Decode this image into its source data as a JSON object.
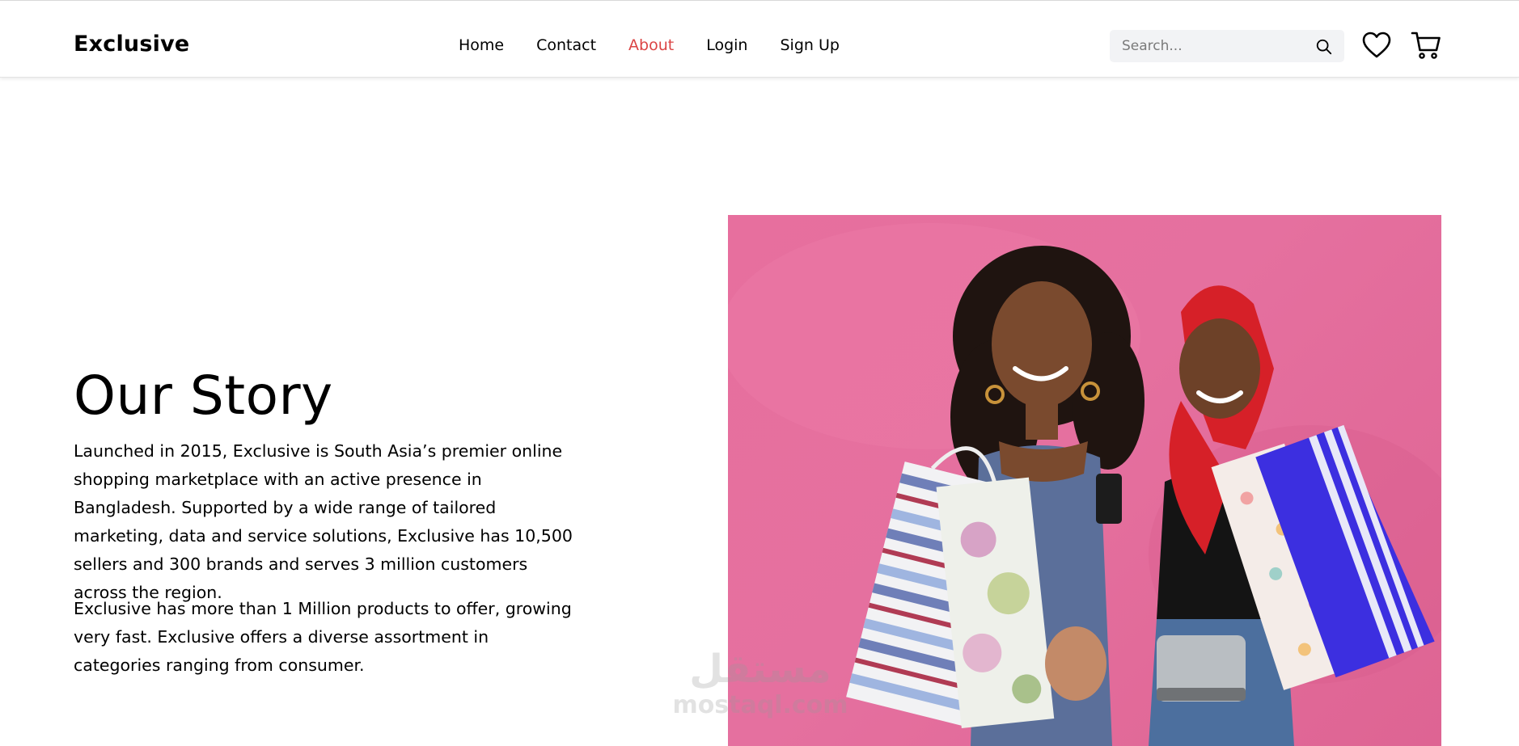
{
  "header": {
    "logo": "Exclusive",
    "nav": [
      {
        "label": "Home"
      },
      {
        "label": "Contact"
      },
      {
        "label": "About"
      },
      {
        "label": "Login"
      },
      {
        "label": "Sign Up"
      }
    ],
    "active_nav": "About",
    "search": {
      "placeholder": "Search...",
      "value": "",
      "icon": "search-icon"
    },
    "icons": [
      "heart-icon",
      "cart-icon"
    ]
  },
  "story": {
    "title": "Our Story",
    "paragraph_1": "Launched in 2015, Exclusive is South Asia’s premier online shopping marketplace with an active presence in Bangladesh. Supported by a wide range of tailored marketing, data and service solutions, Exclusive has 10,500 sellers and 300 brands and serves 3 million customers across the region.",
    "paragraph_2": "Exclusive has more than 1 Million products to offer, growing very fast. Exclusive offers a diverse assortment in categories ranging from consumer."
  },
  "watermark": {
    "arabic": "مستقل",
    "latin": "mostaql.com"
  },
  "colors": {
    "accent": "#db4444",
    "photo_background": "#e76f9e",
    "search_background": "#f2f3f5"
  }
}
